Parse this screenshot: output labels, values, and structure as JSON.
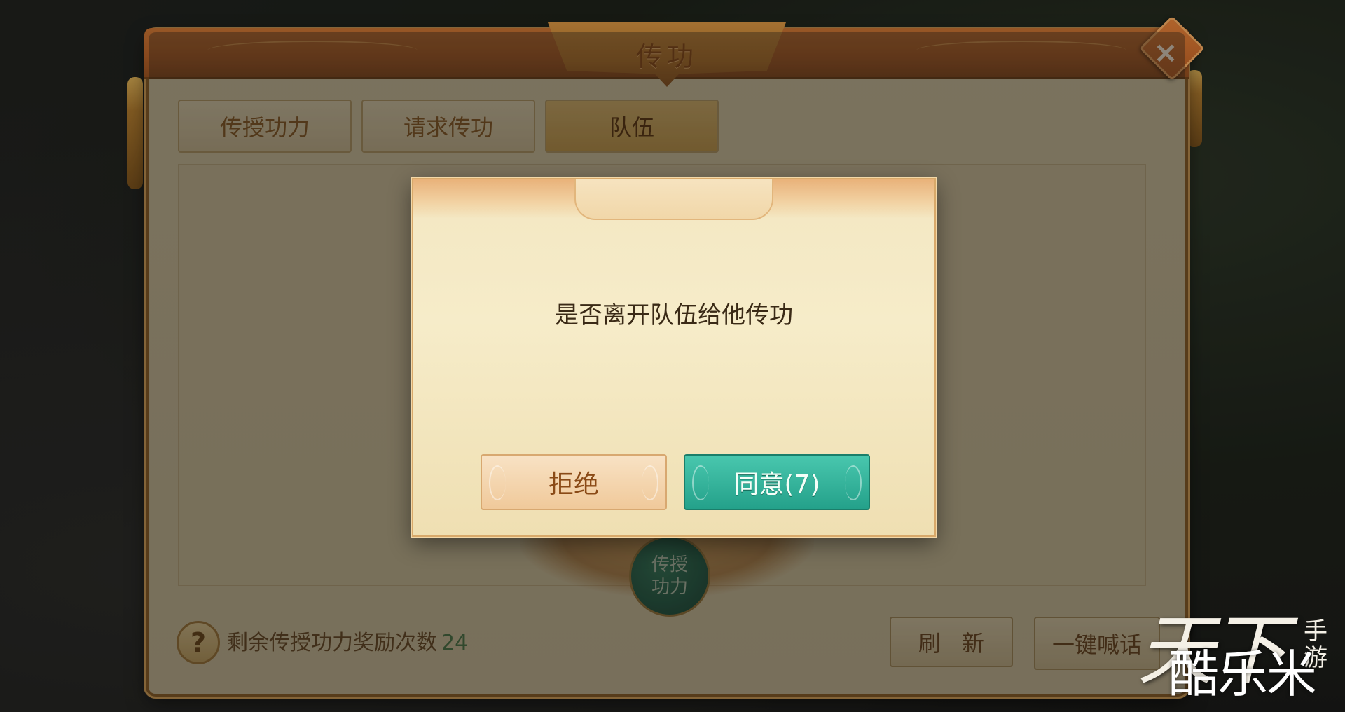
{
  "panel": {
    "title": "传功",
    "close_label": "×",
    "tabs": [
      {
        "label": "传授功力"
      },
      {
        "label": "请求传功"
      },
      {
        "label": "队伍"
      }
    ],
    "center_badge": {
      "line1": "传授",
      "line2": "功力"
    },
    "help_label": "?",
    "reward_text": "剩余传授功力奖励次数",
    "reward_count": "24",
    "refresh_label": "刷新",
    "shout_label": "一键喊话"
  },
  "dialog": {
    "message": "是否离开队伍给他传功",
    "refuse_label": "拒绝",
    "agree_label": "同意(7)"
  },
  "logo": {
    "main": "天下",
    "sub": "手游",
    "site": "酷乐米"
  },
  "colors": {
    "agree_button": "#2fb29a",
    "refuse_button": "#f2cfa2",
    "panel_header": "#a85a25"
  }
}
